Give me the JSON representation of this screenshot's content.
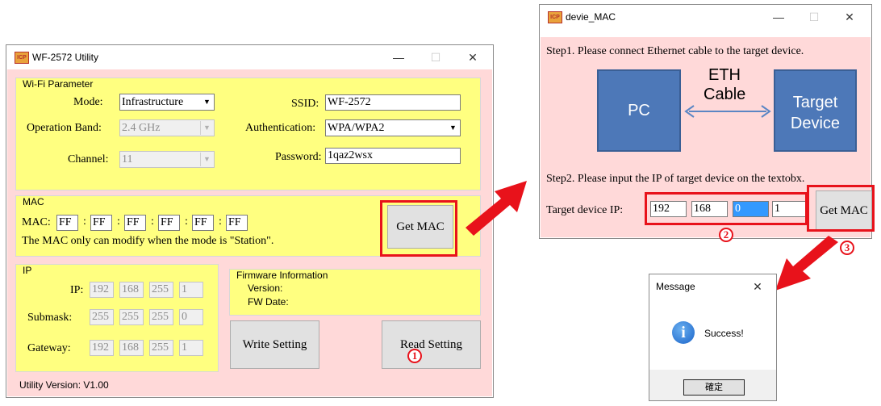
{
  "main_window": {
    "title": "WF-2572 Utility",
    "minimize": "—",
    "maximize": "☐",
    "close": "✕",
    "wifi": {
      "title": "Wi-Fi Parameter",
      "mode_label": "Mode:",
      "mode_value": "Infrastructure",
      "band_label": "Operation Band:",
      "band_value": "2.4 GHz",
      "channel_label": "Channel:",
      "channel_value": "11",
      "ssid_label": "SSID:",
      "ssid_value": "WF-2572",
      "auth_label": "Authentication:",
      "auth_value": "WPA/WPA2",
      "password_label": "Password:",
      "password_value": "1qaz2wsx"
    },
    "mac": {
      "title": "MAC",
      "label": "MAC:",
      "octets": [
        "FF",
        "FF",
        "FF",
        "FF",
        "FF",
        "FF"
      ],
      "separator": ":",
      "note": "The MAC only can modify when the mode is \"Station\".",
      "get_mac_button": "Get MAC"
    },
    "ip": {
      "title": "IP",
      "ip_label": "IP:",
      "ip_values": [
        "192",
        "168",
        "255",
        "1"
      ],
      "submask_label": "Submask:",
      "submask_values": [
        "255",
        "255",
        "255",
        "0"
      ],
      "gateway_label": "Gateway:",
      "gateway_values": [
        "192",
        "168",
        "255",
        "1"
      ]
    },
    "firmware": {
      "title": "Firmware Information",
      "version_label": "Version:",
      "fw_date_label": "FW Date:"
    },
    "write_button": "Write Setting",
    "read_button": "Read Setting",
    "utility_version": "Utility Version: V1.00"
  },
  "mac_window": {
    "title": "devie_MAC",
    "minimize": "—",
    "maximize": "☐",
    "close": "✕",
    "step1": "Step1. Please connect Ethernet cable to the target device.",
    "diagram": {
      "pc": "PC",
      "cable_line1": "ETH",
      "cable_line2": "Cable",
      "target_line1": "Target",
      "target_line2": "Device"
    },
    "step2": "Step2. Please input the IP of target device on the textobx.",
    "target_ip_label": "Target device IP:",
    "target_ip_values": [
      "192",
      "168",
      "0",
      "1"
    ],
    "get_mac_button": "Get MAC"
  },
  "message_box": {
    "title": "Message",
    "close": "✕",
    "icon_letter": "i",
    "text": "Success!",
    "ok_button": "確定"
  },
  "callouts": [
    "1",
    "2",
    "3"
  ],
  "colors": {
    "client_bg": "#ffd9d9",
    "group_bg": "#ffff80",
    "highlight_red": "#e8121b",
    "diagram_blue": "#4d78b8"
  }
}
